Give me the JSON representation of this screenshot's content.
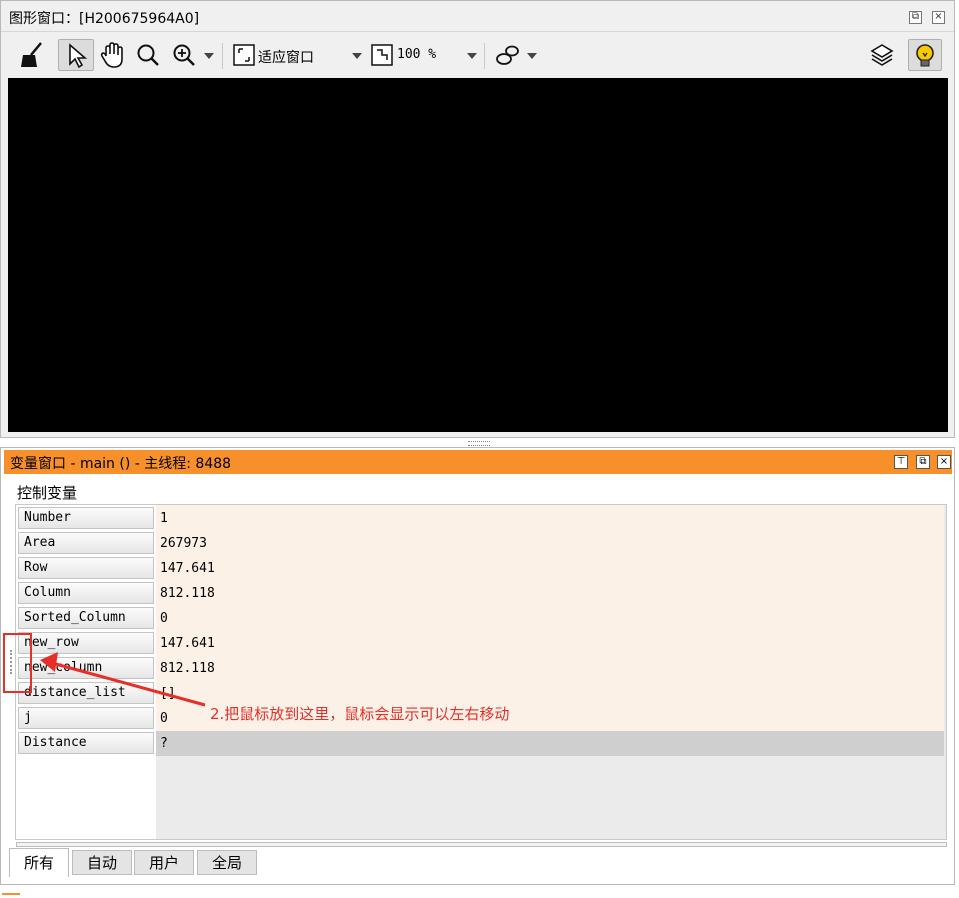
{
  "graphics_window": {
    "title": "图形窗口：[H200675964A0]",
    "toolbar": {
      "fit_label": "适应窗口",
      "zoom_value": "100 %"
    }
  },
  "variable_window": {
    "title": "变量窗口 - main () - 主线程: 8488",
    "section_label": "控制变量",
    "variables": [
      {
        "name": "Number",
        "value": "1"
      },
      {
        "name": "Area",
        "value": "267973"
      },
      {
        "name": "Row",
        "value": "147.641"
      },
      {
        "name": "Column",
        "value": "812.118"
      },
      {
        "name": "Sorted_Column",
        "value": "0"
      },
      {
        "name": "new_row",
        "value": "147.641"
      },
      {
        "name": "new_column",
        "value": "812.118"
      },
      {
        "name": "distance_list",
        "value": "[]"
      },
      {
        "name": "j",
        "value": "0"
      },
      {
        "name": "Distance",
        "value": "?"
      }
    ],
    "tabs": [
      "所有",
      "自动",
      "用户",
      "全局"
    ],
    "active_tab": "所有"
  },
  "annotation": {
    "text": "2.把鼠标放到这里，鼠标会显示可以左右移动",
    "color": "#e5302a"
  },
  "colors": {
    "title_accent": "#f7902a",
    "value_bg": "#fcf1e6"
  }
}
